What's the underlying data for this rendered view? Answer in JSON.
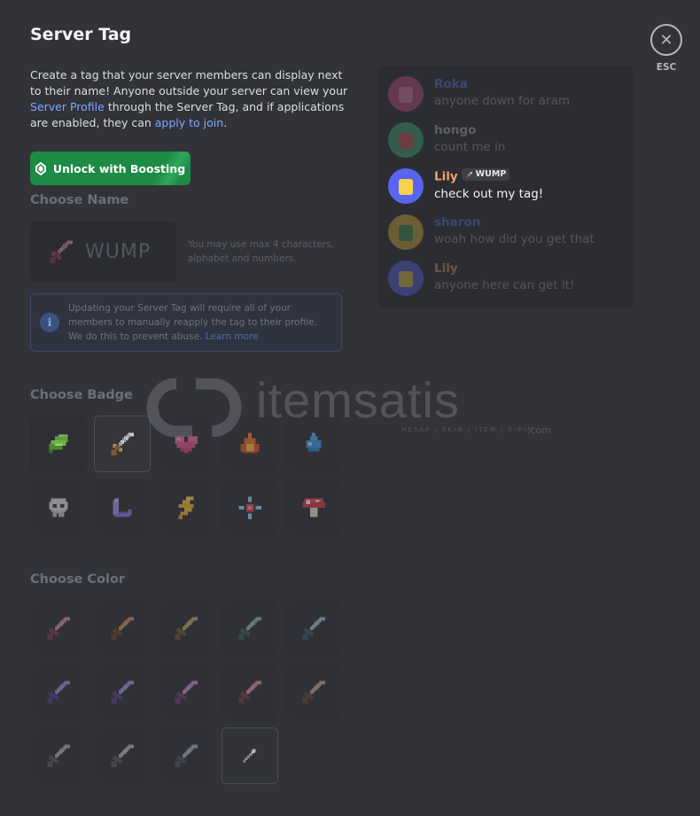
{
  "header": {
    "title": "Server Tag",
    "close_label": "ESC"
  },
  "description": {
    "part1": "Create a tag that your server members can display next to their name! Anyone outside your server can view your ",
    "link1": "Server Profile",
    "part2": " through the Server Tag, and if applications are enabled, they can ",
    "link2": "apply to join",
    "part3": "."
  },
  "boost_button": {
    "label": "Unlock with Boosting",
    "icon": "boost-gem-icon",
    "color": "#1d8a46"
  },
  "choose_name": {
    "label": "Choose Name",
    "tag_value": "WUMP",
    "hint": "You may use max 4 characters, alphabet and numbers."
  },
  "info_notice": {
    "text": "Updating your Server Tag will require all of your members to manually reapply the tag to their profile. We do this to prevent abuse. ",
    "link": "Learn more"
  },
  "choose_badge": {
    "label": "Choose Badge",
    "badges": [
      {
        "icon": "leaf-icon",
        "selected": false
      },
      {
        "icon": "sword-icon",
        "selected": true
      },
      {
        "icon": "heart-icon",
        "selected": false
      },
      {
        "icon": "fire-icon",
        "selected": false
      },
      {
        "icon": "water-drop-icon",
        "selected": false
      },
      {
        "icon": "skull-icon",
        "selected": false
      },
      {
        "icon": "moon-icon",
        "selected": false
      },
      {
        "icon": "lightning-icon",
        "selected": false
      },
      {
        "icon": "crystal-icon",
        "selected": false
      },
      {
        "icon": "mushroom-icon",
        "selected": false
      }
    ]
  },
  "choose_color": {
    "label": "Choose Color",
    "swatches": [
      {
        "blade": "#c58ea6",
        "hilt": "#7b3a52"
      },
      {
        "blade": "#c58f64",
        "hilt": "#6e4226"
      },
      {
        "blade": "#b7a66a",
        "hilt": "#6a5a2a"
      },
      {
        "blade": "#8fb1a5",
        "hilt": "#3e5e56"
      },
      {
        "blade": "#9fb6c8",
        "hilt": "#3f556a"
      },
      {
        "blade": "#9b8fd2",
        "hilt": "#4c3e8a"
      },
      {
        "blade": "#a68fd0",
        "hilt": "#5a3f88"
      },
      {
        "blade": "#c08fc4",
        "hilt": "#6e3d76"
      },
      {
        "blade": "#d2919a",
        "hilt": "#7a3b44"
      },
      {
        "blade": "#bfa28c",
        "hilt": "#5e4636"
      },
      {
        "blade": "#a9aca3",
        "hilt": "#55584f"
      },
      {
        "blade": "#b6b4bc",
        "hilt": "#5a5860"
      },
      {
        "blade": "#a8acb8",
        "hilt": "#4f5360"
      }
    ],
    "picker_icon": "eyedropper-icon"
  },
  "chat_preview": {
    "messages": [
      {
        "user": "Roka",
        "text": "anyone down for aram",
        "name_color": "#5b7cf0",
        "avatar_color": "#c94f8a",
        "face_color": "#f08abf",
        "faded": true
      },
      {
        "user": "hongo",
        "text": "count me in",
        "name_color": "#b8bcc4",
        "avatar_color": "#3fb67a",
        "face_color": "#e06060",
        "faded": true
      },
      {
        "user": "Lily",
        "text": "check out my tag!",
        "name_color": "#f0a070",
        "avatar_color": "#5865f2",
        "face_color": "#f5d24a",
        "faded": false,
        "tag": "WUMP"
      },
      {
        "user": "sharon",
        "text": "woah how did you get that",
        "name_color": "#5b7cf0",
        "avatar_color": "#e0b83a",
        "face_color": "#3fa05a",
        "faded": true
      },
      {
        "user": "Lily",
        "text": "anyone here can get it!",
        "name_color": "#f0a070",
        "avatar_color": "#5865f2",
        "face_color": "#f5d24a",
        "faded": true
      }
    ]
  },
  "watermark": {
    "brand": "itemsatis",
    "sub": "HESAP / SKIN / ITEM / E-PIN",
    "suffix": ".com"
  }
}
